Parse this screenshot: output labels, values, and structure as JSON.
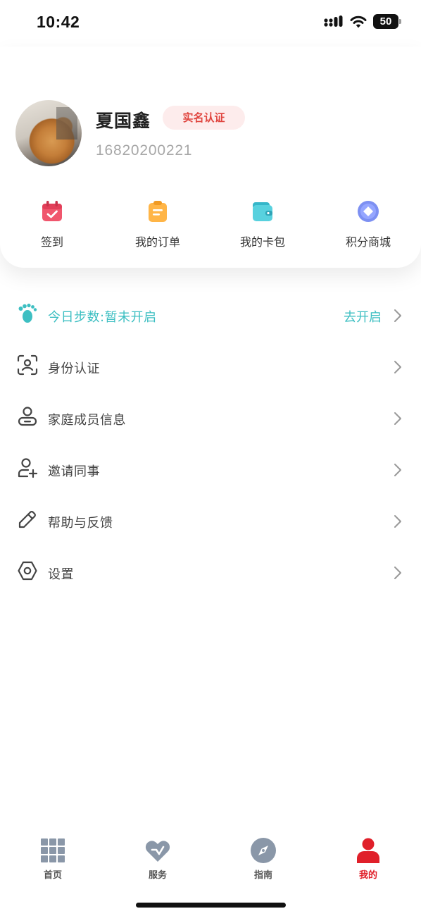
{
  "status_bar": {
    "time": "10:42",
    "battery": "50"
  },
  "profile": {
    "name": "夏国鑫",
    "verify_badge": "实名认证",
    "phone": "16820200221"
  },
  "quick_actions": [
    {
      "label": "签到",
      "icon": "calendar-check-icon"
    },
    {
      "label": "我的订单",
      "icon": "clipboard-icon"
    },
    {
      "label": "我的卡包",
      "icon": "wallet-icon"
    },
    {
      "label": "积分商城",
      "icon": "points-diamond-icon"
    }
  ],
  "menu": {
    "steps": {
      "label": "今日步数:暂未开启",
      "action": "去开启",
      "icon": "footprint-icon"
    },
    "items": [
      {
        "label": "身份认证",
        "icon": "face-scan-icon"
      },
      {
        "label": "家庭成员信息",
        "icon": "family-member-icon"
      },
      {
        "label": "邀请同事",
        "icon": "add-user-icon"
      },
      {
        "label": "帮助与反馈",
        "icon": "edit-pen-icon"
      },
      {
        "label": "设置",
        "icon": "settings-hexagon-icon"
      }
    ]
  },
  "tab_bar": {
    "items": [
      {
        "label": "首页",
        "icon": "grid-icon"
      },
      {
        "label": "服务",
        "icon": "heart-icon"
      },
      {
        "label": "指南",
        "icon": "compass-icon"
      },
      {
        "label": "我的",
        "icon": "user-icon",
        "active": true
      }
    ]
  },
  "colors": {
    "accent_teal": "#3dbfc2",
    "active_red": "#e0202a",
    "badge_text": "#e0453f",
    "badge_bg": "#fdecec"
  }
}
